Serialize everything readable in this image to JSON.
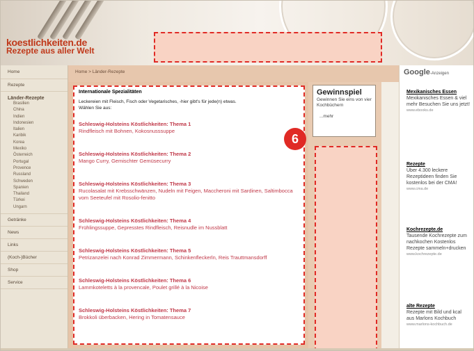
{
  "header": {
    "logo_title": "koestlichkeiten.de",
    "logo_subtitle": "Rezepte aus aller Welt"
  },
  "nav": {
    "home": "Home",
    "rezepte": "Rezepte",
    "laender_heading": "Länder-Rezepte",
    "countries": [
      "Brasilien",
      "China",
      "Indien",
      "Indonesien",
      "Italien",
      "Karibik",
      "Korea",
      "Mexiko",
      "Österreich",
      "Portugal",
      "Provence",
      "Russland",
      "Schweden",
      "Spanien",
      "Thailand",
      "Türkei",
      "Ungarn"
    ],
    "bottom_items": [
      "Getränke",
      "News",
      "Links",
      "(Koch-)Bücher",
      "Shop",
      "Service"
    ]
  },
  "breadcrumb": "Home > Länder-Rezepte",
  "content": {
    "heading": "Internationale Spezialitäten",
    "intro": "Leckereien mit Fleisch, Fisch oder Vegetarisches, -hier gibt's für jede(n) etwas. Wählen Sie aus:",
    "items": [
      {
        "title": "Schleswig-Holsteins Köstlichkeiten: Thema 1",
        "desc": "Rindfleisch mit Bohnen, Kokosnusssuppe"
      },
      {
        "title": "Schleswig-Holsteins Köstlichkeiten: Thema 2",
        "desc": "Mango Curry, Gemischter Gemüsecurry"
      },
      {
        "title": "Schleswig-Holsteins Köstlichkeiten: Thema 3",
        "desc": "Rucolasalat mit Krebsschwänzen, Nudeln mit Feigen, Maccheroni mit Sardinen, Saltimbocca vom Seeteufel mit Rosolio-fenitto"
      },
      {
        "title": "Schleswig-Holsteins Köstlichkeiten: Thema 4",
        "desc": "Frühlingssuppe, Gepresstes Rindfleisch, Reisnudle im Nussblatt"
      },
      {
        "title": "Schleswig-Holsteins Köstlichkeiten: Thema 5",
        "desc": "Petrizanzelei nach Konrad Zimmermann, Schinkenfleckerln, Reis Trauttmansdorff"
      },
      {
        "title": "Schleswig-Holsteins Köstlichkeiten: Thema 6",
        "desc": "Lammkoteletts à la provencale, Poulet grillé à la Nicoise"
      },
      {
        "title": "Schleswig-Holsteins Köstlichkeiten: Thema 7",
        "desc": "Brokkoli überbacken, Hering in Tomatensauce"
      }
    ]
  },
  "gewinnspiel": {
    "title": "Gewinnspiel",
    "text": "Gewinnen Sie eins von vier Kochbüchern",
    "more": "...mehr"
  },
  "badge": "6",
  "ads": {
    "google_word": "Google",
    "google_suffix": "-Anzeigen",
    "items": [
      {
        "title": "Mexikanisches Essen",
        "text": "Mexikanisches Essen & viel mehr Besuchen Sie uns jetzt!",
        "url": "www.ebooks.de"
      },
      {
        "title": "Rezepte",
        "text": "Über 4.300 leckere Rezeptideen finden Sie kostenlos bei der CMA!",
        "url": "www.cma.de"
      },
      {
        "title": "Kochrezepte.de",
        "text": "Tausende Kochrezepte zum nachkochen Kostenlos Rezepte sammeln+drucken",
        "url": "www.kochrezepte.de"
      },
      {
        "title": "alte Rezepte",
        "text": "Rezepte mit Bild und kcal aus Marlons Kochbuch",
        "url": "www.marlons-kochbuch.de"
      }
    ]
  },
  "colors": {
    "accent_red": "#e02a25",
    "link_red": "#c03848",
    "placeholder_fill": "#f9d3c4"
  }
}
